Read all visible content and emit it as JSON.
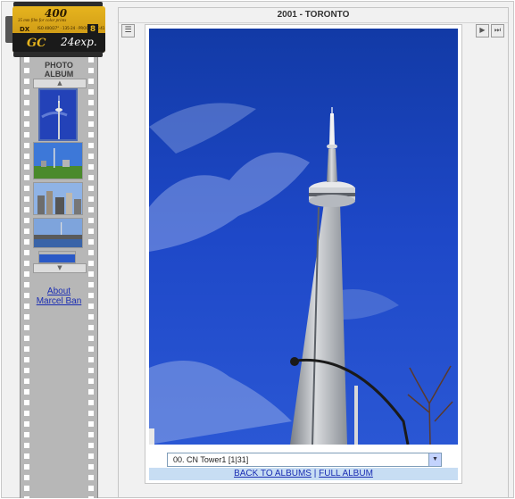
{
  "film_canister": {
    "iso": "400",
    "film_line": "35 mm film for color prints",
    "dx": "DX",
    "fine_print": "ISO 400/27° · 135-24 · PROCESS C-41",
    "frame_count_badge": "8",
    "brand": "GC",
    "exposures": "24exp."
  },
  "sidebar": {
    "album_title_line1": "PHOTO",
    "album_title_line2": "ALBUM",
    "scroll_up_glyph": "▲",
    "scroll_down_glyph": "▼",
    "about_line1": "About",
    "about_line2": "Marcel Ban",
    "thumbnails": [
      {
        "label": "CN Tower thumbnail",
        "selected": true
      },
      {
        "label": "Toronto skyline park",
        "selected": false
      },
      {
        "label": "City buildings",
        "selected": false
      },
      {
        "label": "Lake view",
        "selected": false
      },
      {
        "label": "Sky",
        "selected": false
      }
    ]
  },
  "main": {
    "album_heading": "2001 - TORONTO",
    "menu_icon": "☰",
    "prev_icon": "▶|",
    "last_icon": "▶▶|",
    "photo_select_value": "00. CN Tower1  [1|31]",
    "dropdown_glyph": "▼",
    "back_link": "BACK TO ALBUMS",
    "separator": "|",
    "full_album_link": "FULL ALBUM"
  },
  "colors": {
    "link": "#1a2db3",
    "sky": "#1a3fbf",
    "link_bar": "#c7ddf3"
  }
}
